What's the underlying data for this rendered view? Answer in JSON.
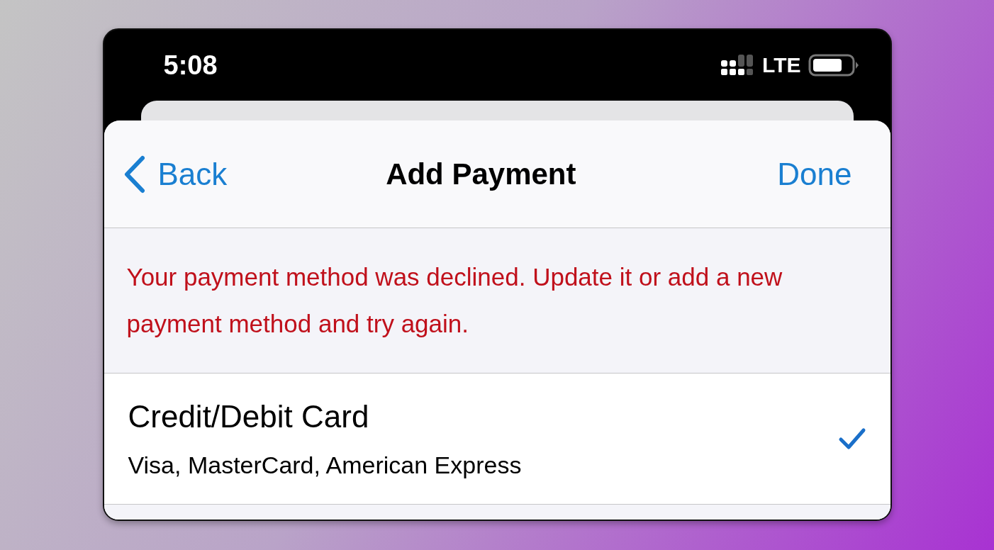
{
  "status_bar": {
    "time": "5:08",
    "network": "LTE"
  },
  "nav": {
    "back": "Back",
    "title": "Add Payment",
    "done": "Done"
  },
  "error_message": "Your payment method was declined. Update it or add a new payment method and try again.",
  "payment_methods": [
    {
      "title": "Credit/Debit Card",
      "subtitle": "Visa, MasterCard, American Express",
      "selected": true
    }
  ]
}
